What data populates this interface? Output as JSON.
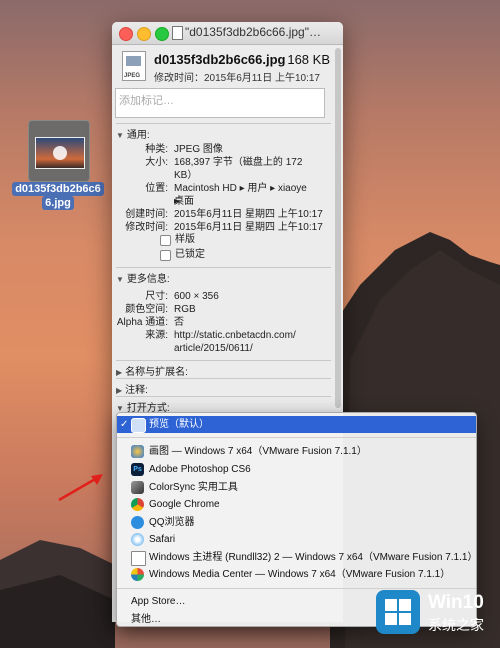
{
  "desktop": {
    "file_label_line1": "d0135f3db2b6c6",
    "file_label_line2": "6.jpg"
  },
  "window": {
    "title": "\"d0135f3db2b6c66.jpg\"…",
    "file_name": "d0135f3db2b6c66.jpg",
    "file_size": "168 KB",
    "modified": "修改时间：2015年6月11日 上午10:17",
    "tags_placeholder": "添加标记…",
    "icon_tag": "JPEG",
    "general": {
      "header": "通用:",
      "kind_label": "种类:",
      "kind": "JPEG 图像",
      "size_label": "大小:",
      "size_line1": "168,397 字节（磁盘上的 172",
      "size_line2": "KB）",
      "where_label": "位置:",
      "where_line1": "Macintosh HD ▸ 用户 ▸ xiaoye ▸",
      "where_line2": "桌面",
      "created_label": "创建时间:",
      "created": "2015年6月11日 星期四 上午10:17",
      "modified_label": "修改时间:",
      "modified": "2015年6月11日 星期四 上午10:17",
      "stationery": "样版",
      "locked": "已锁定"
    },
    "more": {
      "header": "更多信息:",
      "dim_label": "尺寸:",
      "dim": "600 × 356",
      "color_label": "颜色空间:",
      "color": "RGB",
      "alpha_label": "Alpha 通道:",
      "alpha": "否",
      "source_label": "来源:",
      "source_line1": "http://static.cnbetacdn.com/",
      "source_line2": "article/2015/0611/"
    },
    "name_ext": "名称与扩展名:",
    "comments": "注释:",
    "open_with": "打开方式:"
  },
  "menu": {
    "selected": "预览（默认）",
    "apps": [
      "画图 — Windows 7 x64（VMware Fusion 7.1.1）",
      "Adobe Photoshop CS6",
      "ColorSync 实用工具",
      "Google Chrome",
      "QQ浏览器",
      "Safari",
      "Windows 主进程 (Rundll32) 2 — Windows 7 x64（VMware Fusion 7.1.1）",
      "Windows Media Center — Windows 7 x64（VMware Fusion 7.1.1）"
    ],
    "app_store": "App Store…",
    "other": "其他…"
  },
  "logo": {
    "title": "Win10",
    "subtitle": "系统之家"
  }
}
